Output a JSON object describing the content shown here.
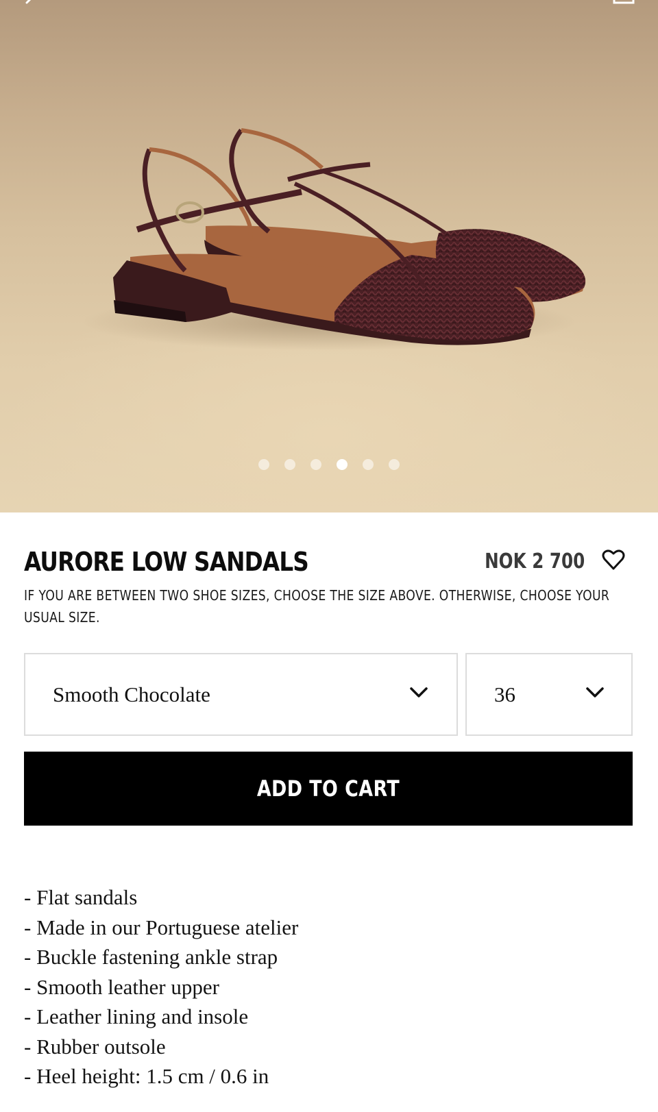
{
  "gallery": {
    "image_alt": "Braided leather slingback sandals",
    "dot_count": 6,
    "active_index": 3
  },
  "product": {
    "title": "AURORE LOW SANDALS",
    "price": "NOK 2 700",
    "size_advice": "If you are between two shoe sizes, choose the size above. Otherwise, choose your usual size."
  },
  "selectors": {
    "color": {
      "selected": "Smooth Chocolate"
    },
    "size": {
      "selected": "36"
    }
  },
  "actions": {
    "add_to_cart_label": "ADD TO CART"
  },
  "description": [
    "- Flat sandals",
    "- Made in our Portuguese atelier",
    "- Buckle fastening ankle strap",
    "- Smooth leather upper",
    "- Leather lining and insole",
    "- Rubber outsole",
    "- Heel height: 1.5 cm / 0.6 in"
  ],
  "colors": {
    "background": "#ffffff",
    "button": "#000000",
    "button_text": "#ffffff",
    "border": "#dcdcdc",
    "sandal": "#4a1f24",
    "sole": "#a8663f"
  },
  "icons": [
    "back-arrow-icon",
    "shopping-bag-icon",
    "heart-icon",
    "chevron-down-icon"
  ]
}
